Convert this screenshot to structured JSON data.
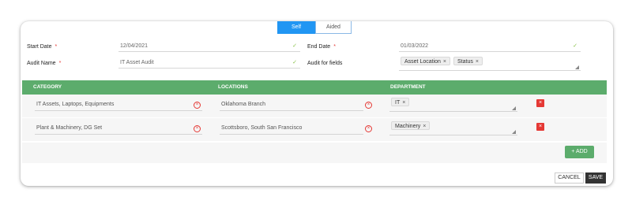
{
  "mode_tabs": {
    "self": "Self",
    "aided": "Aided"
  },
  "form": {
    "start_date": {
      "label": "Start Date",
      "required": "*",
      "value": "12/04/2021"
    },
    "end_date": {
      "label": "End Date",
      "required": "*",
      "value": "01/03/2022"
    },
    "audit_name": {
      "label": "Audit Name",
      "required": "*",
      "value": "IT Asset Audit"
    },
    "audit_fields": {
      "label": "Audit for fields",
      "chips": [
        "Asset Location",
        "Status"
      ]
    }
  },
  "table": {
    "headers": {
      "category": "CATEGORY",
      "locations": "LOCATIONS",
      "department": "DEPARTMENT"
    },
    "rows": [
      {
        "category": "IT Assets, Laptops, Equipments",
        "location": "Oklahoma Branch",
        "department": "IT"
      },
      {
        "category": "Plant & Machinery, DG Set",
        "location": "Scottsboro, South San Francisco",
        "department": "Machinery"
      }
    ]
  },
  "icons": {
    "check": "✓",
    "clear": "×",
    "chip_remove": "×",
    "delete": "×",
    "plus": "+"
  },
  "buttons": {
    "add": "ADD",
    "cancel": "CANCEL",
    "save": "SAVE"
  },
  "colors": {
    "tab_active": "#2196f3",
    "table_header": "#5cac6c",
    "danger": "#e53935",
    "check": "#8bc34a"
  }
}
